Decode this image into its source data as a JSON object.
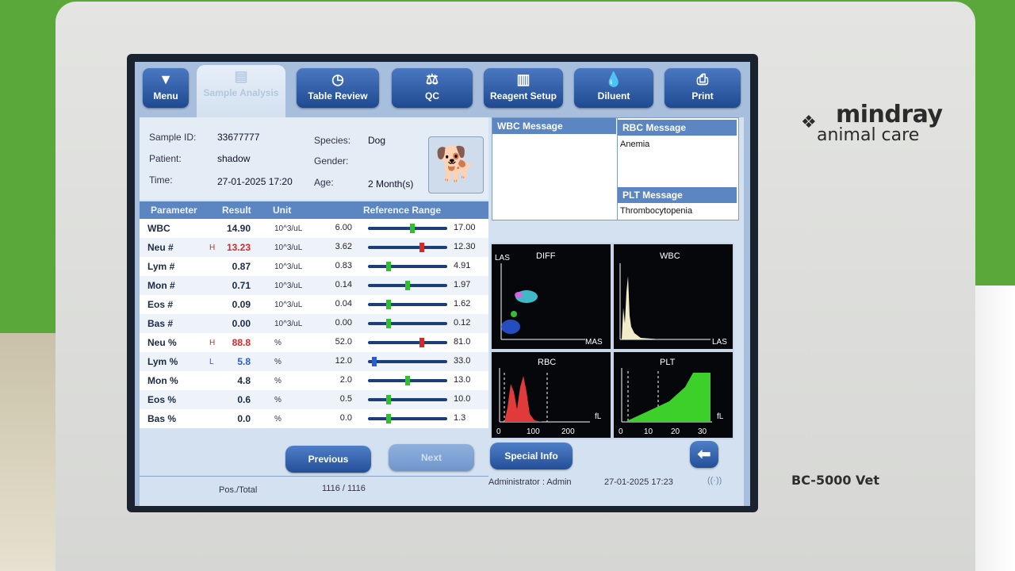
{
  "brand": {
    "line1": "mindray",
    "line2": "animal care",
    "model": "BC-5000 Vet"
  },
  "tabs": [
    {
      "label": "Menu",
      "icon": "menu-arrow-icon"
    },
    {
      "label": "Sample Analysis",
      "icon": "chart-icon",
      "active": true
    },
    {
      "label": "Table Review",
      "icon": "clock-icon"
    },
    {
      "label": "QC",
      "icon": "scale-icon"
    },
    {
      "label": "Reagent Setup",
      "icon": "bottle-icon"
    },
    {
      "label": "Diluent",
      "icon": "droplet-icon"
    },
    {
      "label": "Print",
      "icon": "printer-icon"
    }
  ],
  "sample": {
    "id_label": "Sample ID:",
    "id": "33677777",
    "patient_label": "Patient:",
    "patient": "shadow",
    "time_label": "Time:",
    "time": "27-01-2025 17:20",
    "species_label": "Species:",
    "species": "Dog",
    "gender_label": "Gender:",
    "gender": "",
    "age_label": "Age:",
    "age": "2 Month(s)"
  },
  "table": {
    "headers": [
      "Parameter",
      "Result",
      "Unit",
      "Reference Range"
    ],
    "rows": [
      {
        "name": "WBC",
        "flag": "",
        "result": "14.90",
        "unit": "10^3/uL",
        "low": "6.00",
        "high": "17.00",
        "marker": 0.55
      },
      {
        "name": "Neu #",
        "flag": "H",
        "result": "13.23",
        "unit": "10^3/uL",
        "low": "3.62",
        "high": "12.30",
        "marker": 0.72
      },
      {
        "name": "Lym #",
        "flag": "",
        "result": "0.87",
        "unit": "10^3/uL",
        "low": "0.83",
        "high": "4.91",
        "marker": 0.1
      },
      {
        "name": "Mon #",
        "flag": "",
        "result": "0.71",
        "unit": "10^3/uL",
        "low": "0.14",
        "high": "1.97",
        "marker": 0.45
      },
      {
        "name": "Eos #",
        "flag": "",
        "result": "0.09",
        "unit": "10^3/uL",
        "low": "0.04",
        "high": "1.62",
        "marker": 0.1
      },
      {
        "name": "Bas #",
        "flag": "",
        "result": "0.00",
        "unit": "10^3/uL",
        "low": "0.00",
        "high": "0.12",
        "marker": 0.1
      },
      {
        "name": "Neu %",
        "flag": "H",
        "result": "88.8",
        "unit": "%",
        "low": "52.0",
        "high": "81.0",
        "marker": 0.72
      },
      {
        "name": "Lym %",
        "flag": "L",
        "result": "5.8",
        "unit": "%",
        "low": "12.0",
        "high": "33.0",
        "marker": -0.16
      },
      {
        "name": "Mon %",
        "flag": "",
        "result": "4.8",
        "unit": "%",
        "low": "2.0",
        "high": "13.0",
        "marker": 0.45
      },
      {
        "name": "Eos %",
        "flag": "",
        "result": "0.6",
        "unit": "%",
        "low": "0.5",
        "high": "10.0",
        "marker": 0.1
      },
      {
        "name": "Bas %",
        "flag": "",
        "result": "0.0",
        "unit": "%",
        "low": "0.0",
        "high": "1.3",
        "marker": 0.1
      }
    ]
  },
  "messages": {
    "wbc_title": "WBC Message",
    "wbc_text": "",
    "rbc_title": "RBC Message",
    "rbc_text": "Anemia",
    "plt_title": "PLT Message",
    "plt_text": "Thrombocytopenia"
  },
  "plots": {
    "diff": {
      "title": "DIFF",
      "ylabel": "LAS",
      "xlabel": "MAS"
    },
    "wbc": {
      "title": "WBC",
      "xlabel": "LAS"
    },
    "rbc": {
      "title": "RBC",
      "unit": "fL",
      "ticks": [
        "0",
        "100",
        "200"
      ]
    },
    "plt": {
      "title": "PLT",
      "unit": "fL",
      "ticks": [
        "0",
        "10",
        "20",
        "30"
      ]
    }
  },
  "buttons": {
    "previous": "Previous",
    "next": "Next",
    "special": "Special Info"
  },
  "status": {
    "pos_label": "Pos./Total",
    "pos_value": "1116 / 1116",
    "user": "Administrator : Admin",
    "datetime": "27-01-2025 17:23"
  },
  "colors": {
    "flag_high": "#d42a2a",
    "flag_low": "#2a5ad4",
    "marker_normal": "#2fbf2f",
    "marker_high": "#d42a2a",
    "marker_low": "#2a5ad4"
  }
}
